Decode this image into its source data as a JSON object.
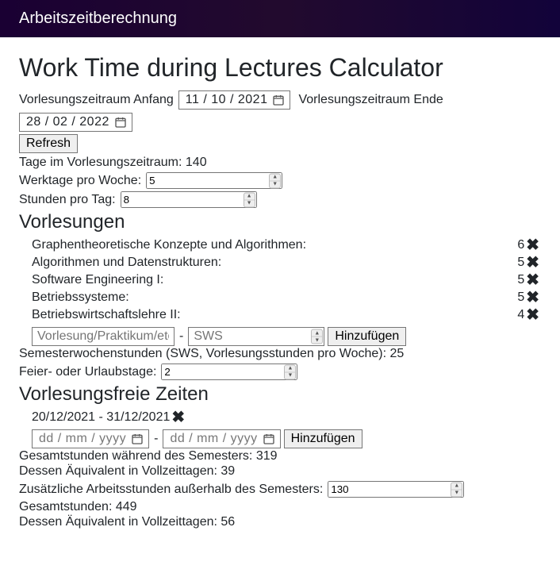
{
  "navbar": {
    "brand": "Arbeitszeitberechnung"
  },
  "title": "Work Time during Lectures Calculator",
  "period": {
    "start_label": "Vorlesungszeitraum Anfang",
    "start_value": "11 / 10 / 2021",
    "end_label": "Vorlesungszeitraum Ende",
    "end_value": "28 / 02 / 2022"
  },
  "refresh_label": "Refresh",
  "days_in_period": {
    "label": "Tage im Vorlesungszeitraum:",
    "value": "140"
  },
  "workdays": {
    "label": "Werktage pro Woche:",
    "value": "5"
  },
  "hours_per_day": {
    "label": "Stunden pro Tag:",
    "value": "8"
  },
  "lectures_heading": "Vorlesungen",
  "lectures": [
    {
      "name": "Graphentheoretische Konzepte und Algorithmen:",
      "sws": "6"
    },
    {
      "name": "Algorithmen und Datenstrukturen:",
      "sws": "5"
    },
    {
      "name": "Software Engineering I:",
      "sws": "5"
    },
    {
      "name": "Betriebssysteme:",
      "sws": "5"
    },
    {
      "name": "Betriebswirtschaftslehre II:",
      "sws": "4"
    }
  ],
  "add_lecture": {
    "name_placeholder": "Vorlesung/Praktikum/etc",
    "sws_placeholder": "SWS",
    "button": "Hinzufügen"
  },
  "sws_total": {
    "label": "Semesterwochenstunden (SWS, Vorlesungsstunden pro Woche):",
    "value": "25"
  },
  "holidays": {
    "label": "Feier- oder Urlaubstage:",
    "value": "2"
  },
  "free_heading": "Vorlesungsfreie Zeiten",
  "free_periods": [
    {
      "range": "20/12/2021 - 31/12/2021"
    }
  ],
  "add_free": {
    "from_placeholder": "dd / mm / yyyy",
    "to_placeholder": "dd / mm / yyyy",
    "button": "Hinzufügen"
  },
  "semester_hours": {
    "label": "Gesamtstunden während des Semesters:",
    "value": "319"
  },
  "semester_days_eq": {
    "label": "Dessen Äquivalent in Vollzeittagen:",
    "value": "39"
  },
  "extra_hours": {
    "label": "Zusätzliche Arbeitsstunden außerhalb des Semesters:",
    "value": "130"
  },
  "total_hours": {
    "label": "Gesamtstunden:",
    "value": "449"
  },
  "total_days_eq": {
    "label": "Dessen Äquivalent in Vollzeittagen:",
    "value": "56"
  }
}
